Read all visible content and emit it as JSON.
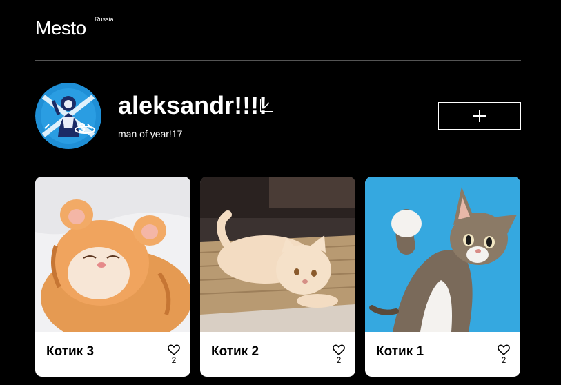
{
  "header": {
    "logo": "Mesto",
    "logo_sub": "Russia"
  },
  "profile": {
    "name": "aleksandr!!!!",
    "about": "man of year!17",
    "avatar_icon": "zenit-hockey-logo-icon",
    "edit_icon": "pencil-icon",
    "add_icon": "plus-icon"
  },
  "cards": [
    {
      "title": "Котик 3",
      "likes": "2",
      "image": "sleeping-ginger-kitten"
    },
    {
      "title": "Котик 2",
      "likes": "2",
      "image": "cream-cat-on-rug"
    },
    {
      "title": "Котик 1",
      "likes": "2",
      "image": "tabby-cat-waving-blue-bg"
    }
  ],
  "colors": {
    "background": "#000000",
    "divider": "#545454",
    "card": "#ffffff",
    "avatar_blue": "#1f8fd6"
  }
}
